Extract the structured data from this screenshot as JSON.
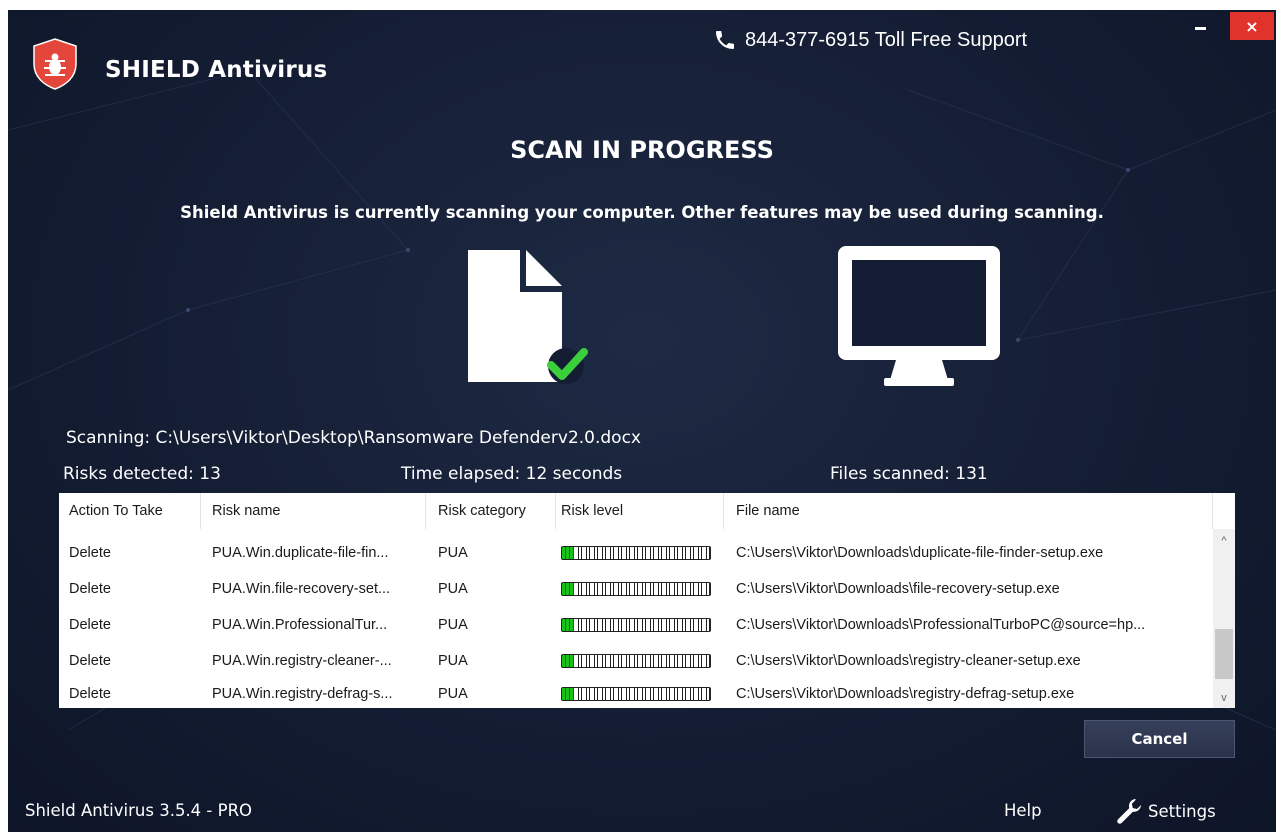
{
  "app": {
    "name": "SHIELD Antivirus",
    "support_phone": "844-377-6915 Toll Free Support",
    "version": "Shield Antivirus 3.5.4 - PRO",
    "close_glyph": "×"
  },
  "scan": {
    "title": "SCAN IN PROGRESS",
    "subtitle": "Shield Antivirus is currently scanning your computer. Other features may be used during scanning.",
    "current_file": "Scanning: C:\\Users\\Viktor\\Desktop\\Ransomware Defenderv2.0.docx",
    "risks_detected": "Risks detected: 13",
    "time_elapsed": "Time elapsed: 12 seconds",
    "files_scanned": "Files scanned: 131"
  },
  "table": {
    "headers": [
      "Action To Take",
      "Risk name",
      "Risk category",
      "Risk level",
      "File name"
    ],
    "rows": [
      {
        "action": "Delete",
        "risk_name": "PUA.Win.duplicate-file-fin...",
        "category": "PUA",
        "level": 0.08,
        "file": "C:\\Users\\Viktor\\Downloads\\duplicate-file-finder-setup.exe"
      },
      {
        "action": "Delete",
        "risk_name": "PUA.Win.file-recovery-set...",
        "category": "PUA",
        "level": 0.08,
        "file": "C:\\Users\\Viktor\\Downloads\\file-recovery-setup.exe"
      },
      {
        "action": "Delete",
        "risk_name": "PUA.Win.ProfessionalTur...",
        "category": "PUA",
        "level": 0.08,
        "file": "C:\\Users\\Viktor\\Downloads\\ProfessionalTurboPC@source=hp..."
      },
      {
        "action": "Delete",
        "risk_name": "PUA.Win.registry-cleaner-...",
        "category": "PUA",
        "level": 0.08,
        "file": "C:\\Users\\Viktor\\Downloads\\registry-cleaner-setup.exe"
      },
      {
        "action": "Delete",
        "risk_name": "PUA.Win.registry-defrag-s...",
        "category": "PUA",
        "level": 0.08,
        "file": "C:\\Users\\Viktor\\Downloads\\registry-defrag-setup.exe"
      }
    ]
  },
  "buttons": {
    "cancel": "Cancel",
    "help": "Help",
    "settings": "Settings"
  },
  "scrollbar": {
    "up_glyph": "^",
    "down_glyph": "v"
  },
  "colors": {
    "background": "#141d33",
    "logo_red": "#e4463b",
    "close_red": "#e0332b",
    "check_green": "#3ccf3c",
    "risk_green": "#18c218"
  },
  "icons": {
    "logo": "shield-bug-icon",
    "phone": "phone-icon",
    "document": "document-check-icon",
    "monitor": "monitor-icon",
    "settings": "wrench-icon"
  }
}
